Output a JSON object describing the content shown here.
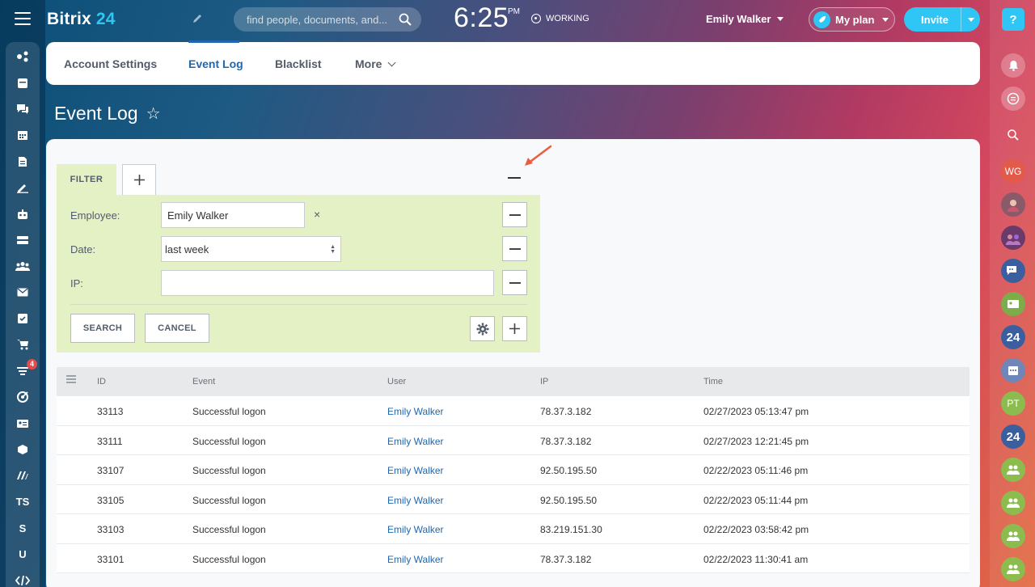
{
  "app": {
    "name": "Bitrix",
    "number": "24"
  },
  "header": {
    "search_placeholder": "find people, documents, and...",
    "time": "6:25",
    "ampm": "PM",
    "status": "WORKING",
    "user": "Emily Walker",
    "plan_label": "My plan",
    "invite_label": "Invite"
  },
  "left_sidebar": {
    "icons": [
      "share-icon",
      "feed-icon",
      "chat-icon",
      "calendar-icon",
      "document-icon",
      "sign-icon",
      "robot-icon",
      "drive-icon",
      "group-icon",
      "mail-icon",
      "tasks-icon",
      "cart-icon",
      "filter-icon",
      "target-icon",
      "contact-card-icon",
      "box-icon",
      "marketplace-icon",
      "ts",
      "s",
      "u",
      "code-icon"
    ],
    "texts": {
      "ts": "TS",
      "s": "S",
      "u": "U"
    },
    "badge": "4"
  },
  "right_rail": {
    "help": "?",
    "wg": "WG",
    "pt": "PT",
    "n24": "24"
  },
  "tabs": {
    "account_settings": "Account Settings",
    "event_log": "Event Log",
    "blacklist": "Blacklist",
    "more": "More"
  },
  "page_title": "Event Log",
  "filter": {
    "tab_label": "FILTER",
    "employee_label": "Employee:",
    "employee_value": "Emily Walker",
    "date_label": "Date:",
    "date_value": "last week",
    "ip_label": "IP:",
    "ip_value": "",
    "search_btn": "SEARCH",
    "cancel_btn": "CANCEL"
  },
  "grid": {
    "headers": {
      "id": "ID",
      "event": "Event",
      "user": "User",
      "ip": "IP",
      "time": "Time"
    },
    "rows": [
      {
        "id": "33113",
        "event": "Successful logon",
        "user": "Emily Walker",
        "ip": "78.37.3.182",
        "time": "02/27/2023 05:13:47 pm"
      },
      {
        "id": "33111",
        "event": "Successful logon",
        "user": "Emily Walker",
        "ip": "78.37.3.182",
        "time": "02/27/2023 12:21:45 pm"
      },
      {
        "id": "33107",
        "event": "Successful logon",
        "user": "Emily Walker",
        "ip": "92.50.195.50",
        "time": "02/22/2023 05:11:46 pm"
      },
      {
        "id": "33105",
        "event": "Successful logon",
        "user": "Emily Walker",
        "ip": "92.50.195.50",
        "time": "02/22/2023 05:11:44 pm"
      },
      {
        "id": "33103",
        "event": "Successful logon",
        "user": "Emily Walker",
        "ip": "83.219.151.30",
        "time": "02/22/2023 03:58:42 pm"
      },
      {
        "id": "33101",
        "event": "Successful logon",
        "user": "Emily Walker",
        "ip": "78.37.3.182",
        "time": "02/22/2023 11:30:41 am"
      }
    ]
  }
}
